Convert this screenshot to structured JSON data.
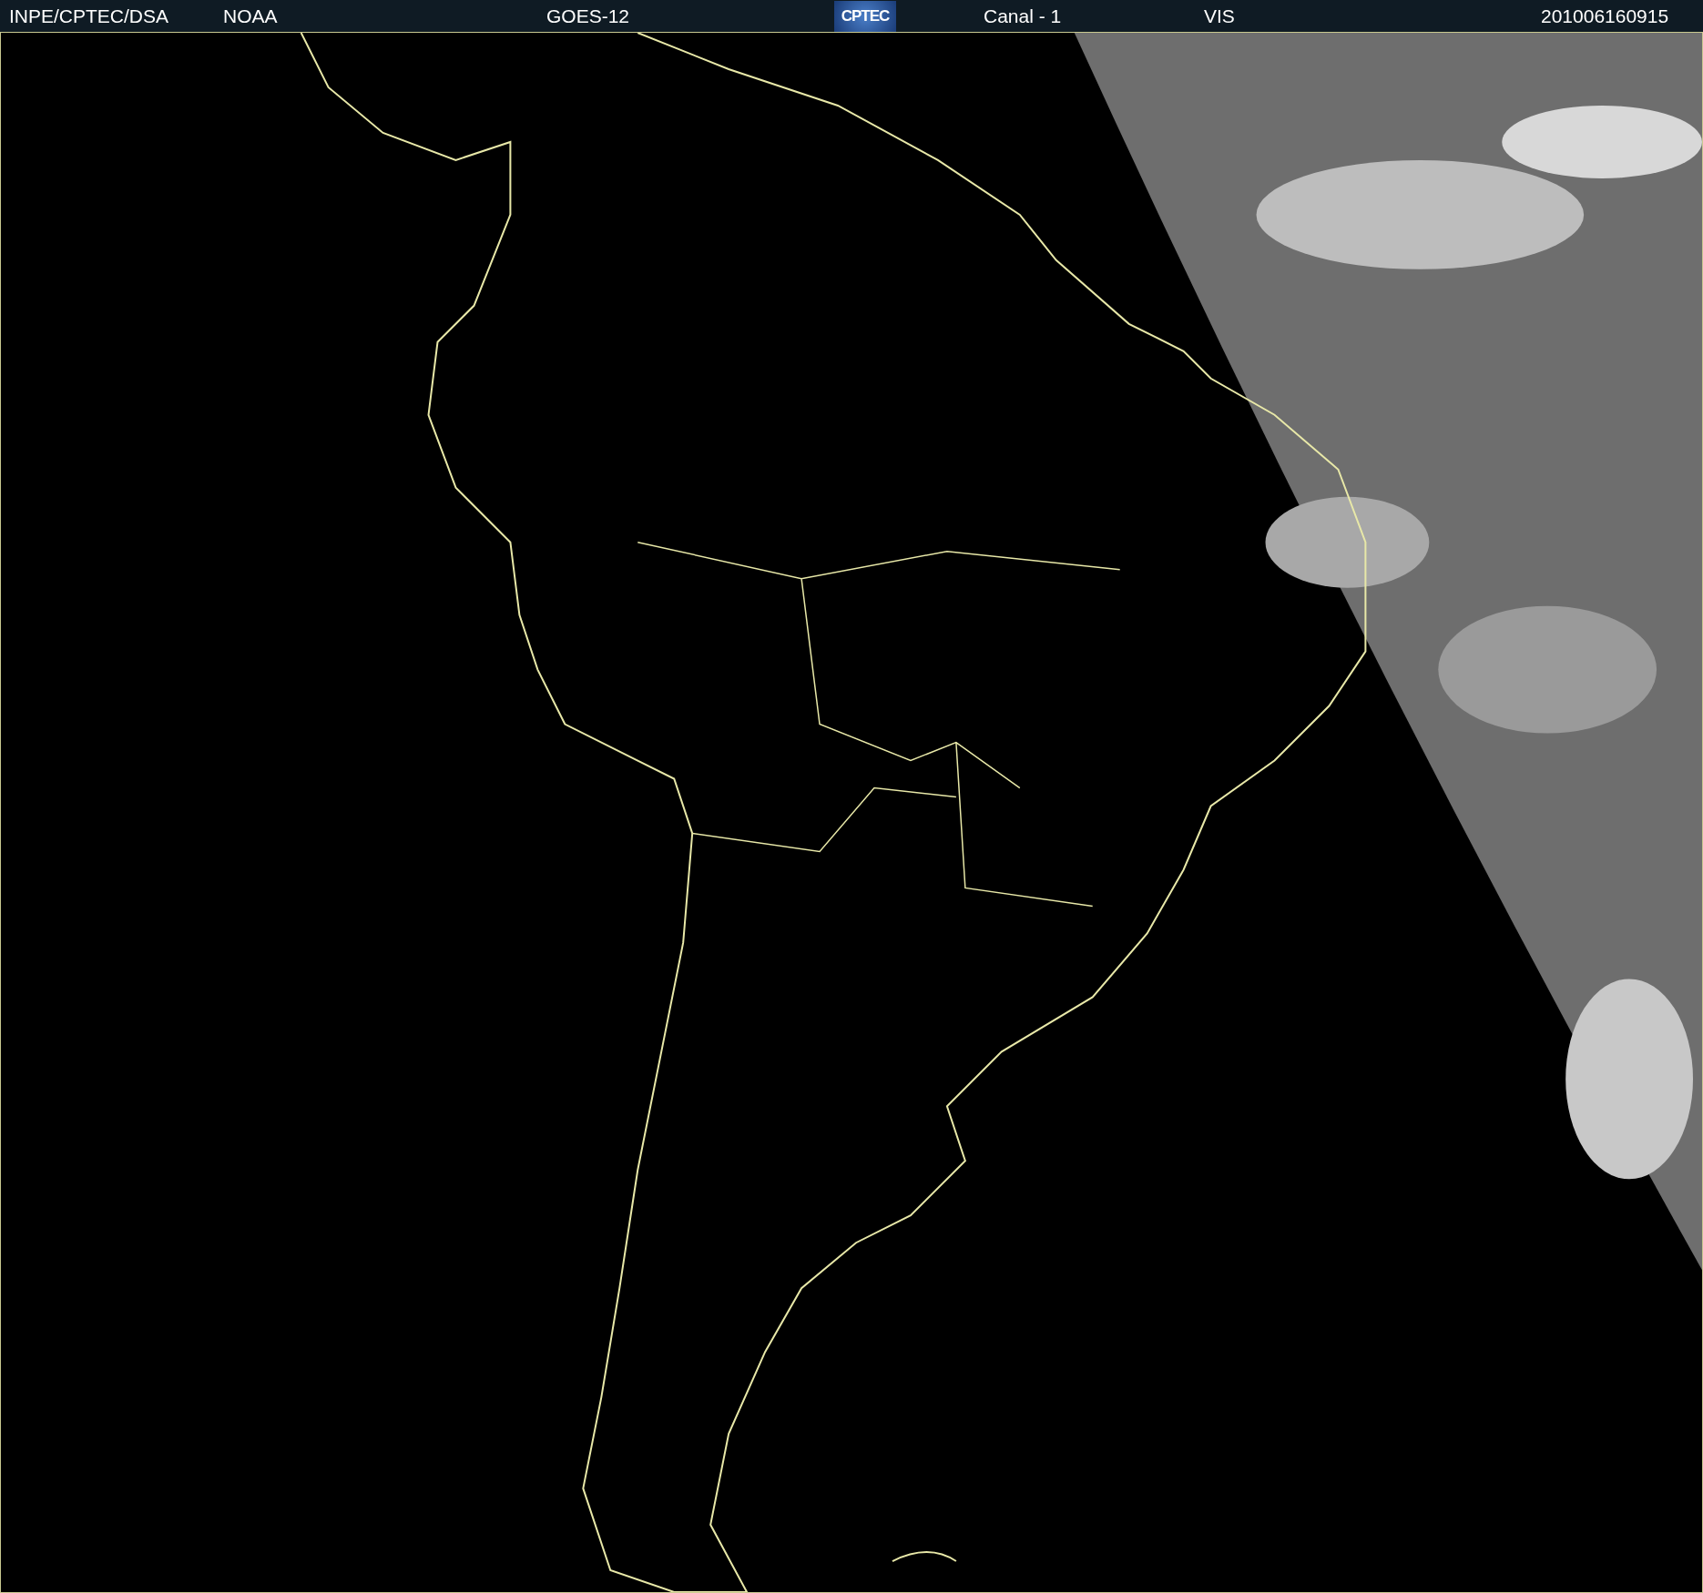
{
  "header": {
    "source": "INPE/CPTEC/DSA",
    "agency": "NOAA",
    "satellite": "GOES-12",
    "logo": "CPTEC",
    "channel": "Canal - 1",
    "band": "VIS",
    "timestamp": "201006160915"
  }
}
